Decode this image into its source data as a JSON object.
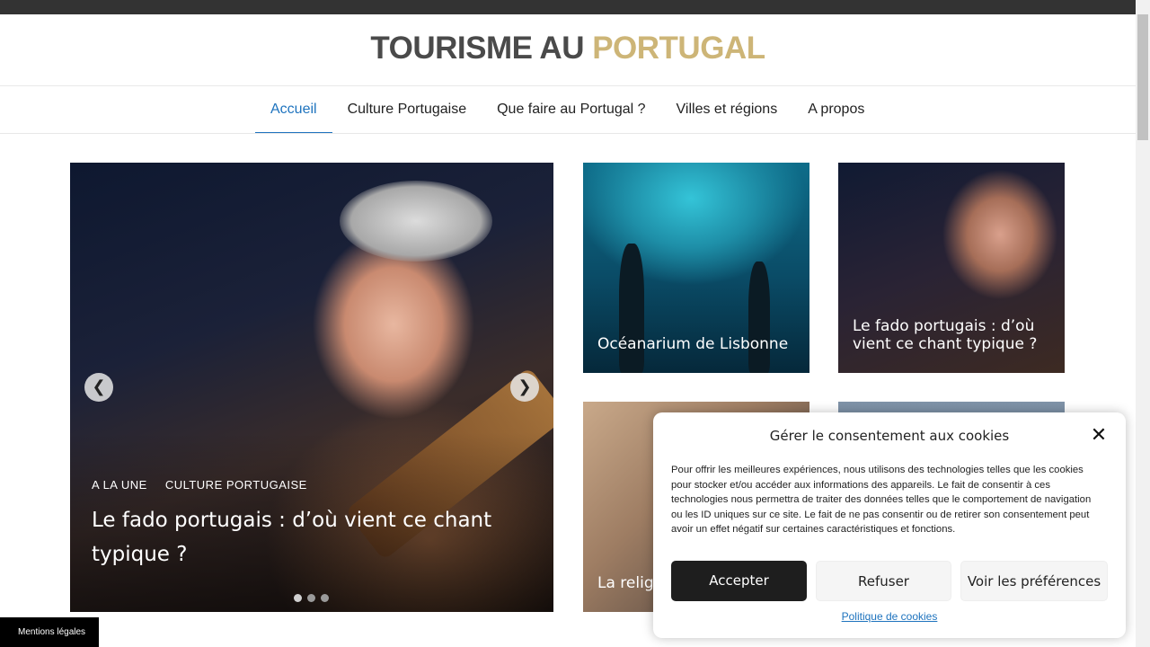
{
  "site": {
    "logo_main": "TOURISME AU ",
    "logo_accent": "PORTUGAL"
  },
  "nav": {
    "items": [
      {
        "label": "Accueil",
        "active": true
      },
      {
        "label": "Culture Portugaise",
        "active": false
      },
      {
        "label": "Que faire au Portugal ?",
        "active": false
      },
      {
        "label": "Villes et régions",
        "active": false
      },
      {
        "label": "A propos",
        "active": false
      }
    ]
  },
  "slider": {
    "categories": [
      "A LA UNE",
      "CULTURE PORTUGAISE"
    ],
    "title": "Le fado portugais : d’où vient ce chant typique ?",
    "prev_icon": "chevron-left-icon",
    "next_icon": "chevron-right-icon",
    "slide_count": 3,
    "active_slide": 1
  },
  "cards": [
    {
      "title": "Océanarium de Lisbonne"
    },
    {
      "title": "Le fado portugais : d’où vient ce chant typique ?"
    },
    {
      "title": "La relig quotidi"
    },
    {
      "title": ""
    }
  ],
  "footer": {
    "mentions": "Mentions légales"
  },
  "cookie": {
    "title": "Gérer le consentement aux cookies",
    "text": "Pour offrir les meilleures expériences, nous utilisons des technologies telles que les cookies pour stocker et/ou accéder aux informations des appareils. Le fait de consentir à ces technologies nous permettra de traiter des données telles que le comportement de navigation ou les ID uniques sur ce site. Le fait de ne pas consentir ou de retirer son consentement peut avoir un effet négatif sur certaines caractéristiques et fonctions.",
    "accept": "Accepter",
    "refuse": "Refuser",
    "preferences": "Voir les préférences",
    "policy_link": "Politique de cookies",
    "close_icon": "close-icon"
  },
  "colors": {
    "accent_gold": "#cdb577",
    "nav_active": "#1e73be",
    "topbar": "#333333"
  }
}
